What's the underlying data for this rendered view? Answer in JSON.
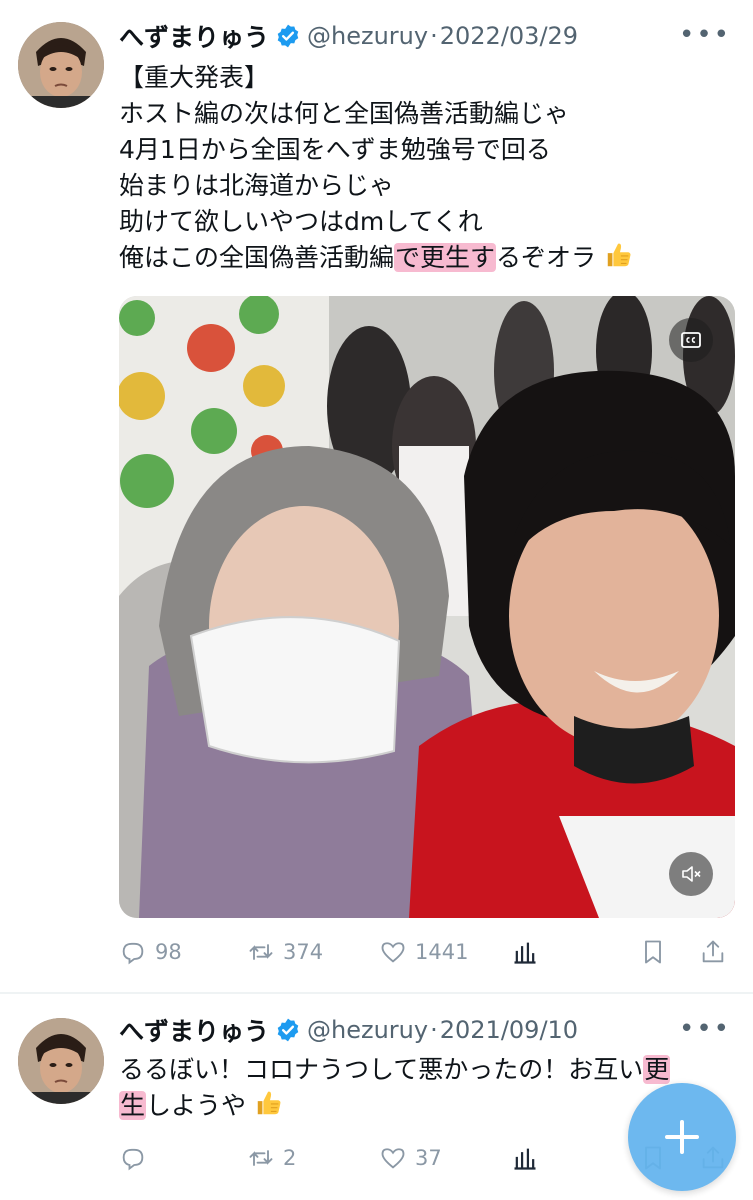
{
  "tweets": [
    {
      "author_name": "へずまりゅう",
      "handle": "@hezuruy",
      "separator": "·",
      "date": "2022/03/29",
      "lines": [
        "【重大発表】",
        "ホスト編の次は何と全国偽善活動編じゃ",
        "4月1日から全国をへずま勉強号で回る",
        "始まりは北海道からじゃ",
        "助けて欲しいやつはdmしてくれ"
      ],
      "last_line": {
        "before": "俺はこの全国偽善活動編",
        "highlight": "で更生す",
        "after": "るぞオラ"
      },
      "stats": {
        "replies": "98",
        "retweets": "374",
        "likes": "1441"
      }
    },
    {
      "author_name": "へずまりゅう",
      "handle": "@hezuruy",
      "separator": "·",
      "date": "2021/09/10",
      "line1": {
        "before": "るるぼい！コロナうつして悪かったの！お互い",
        "highlight": "更"
      },
      "line2": {
        "highlight": "生",
        "after": "しようや"
      },
      "stats": {
        "replies": "",
        "retweets": "2",
        "likes": "37"
      }
    }
  ],
  "icons": {
    "verified": "verified-badge-icon",
    "more": "more-icon",
    "reply": "reply-icon",
    "retweet": "retweet-icon",
    "like": "heart-icon",
    "analytics": "analytics-icon",
    "bookmark": "bookmark-icon",
    "share": "share-icon",
    "captions": "captions-icon",
    "mute": "mute-icon",
    "compose": "compose-icon",
    "thumbs_up": "thumbs-up-emoji"
  },
  "colors": {
    "accent": "#1d9bf0",
    "fab": "#62b3ee",
    "highlight": "#f082aa",
    "secondary_text": "#536471"
  }
}
